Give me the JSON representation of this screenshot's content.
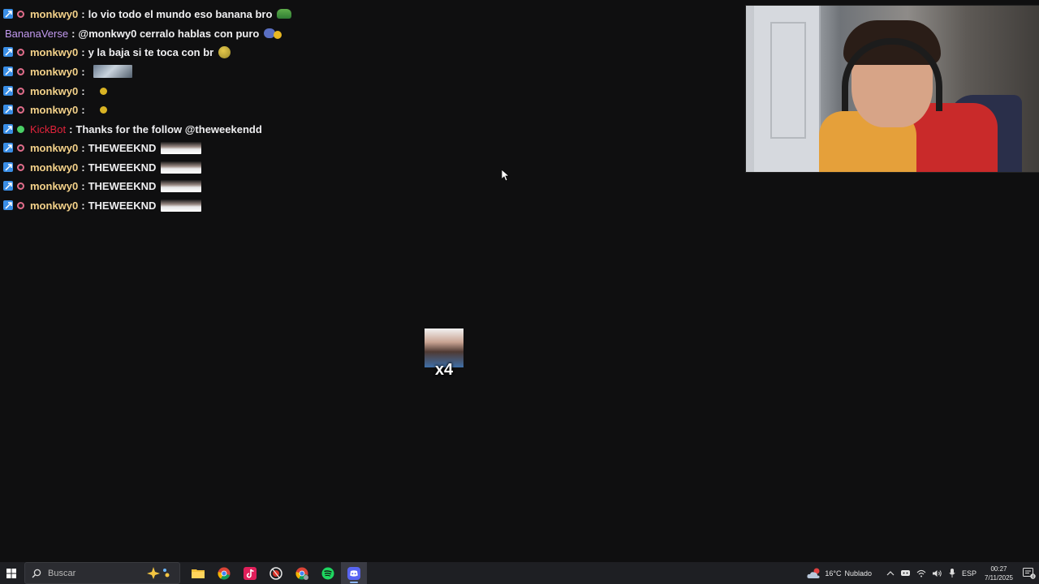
{
  "chat": {
    "messages": [
      {
        "user": "monkwy0",
        "user_color": "#f4d28a",
        "sep": ":",
        "text": "lo vio todo el mundo eso banana bro",
        "emote": "frog-emote"
      },
      {
        "user": "BananaVerse",
        "user_color": "#c39af0",
        "sep": ":",
        "text": "@monkwy0 cerralo hablas con puro",
        "emote": "combo-emote"
      },
      {
        "user": "monkwy0",
        "user_color": "#f4d28a",
        "sep": ":",
        "text": "y la baja si te toca con br",
        "emote": "ball-emote"
      },
      {
        "user": "monkwy0",
        "user_color": "#f4d28a",
        "sep": ":",
        "text": "",
        "emote": "picture-emote"
      },
      {
        "user": "monkwy0",
        "user_color": "#f4d28a",
        "sep": ":",
        "text": "",
        "emote": "small-emote"
      },
      {
        "user": "monkwy0",
        "user_color": "#f4d28a",
        "sep": ":",
        "text": "",
        "emote": "small-emote"
      },
      {
        "user": "KickBot",
        "user_color": "#e2233b",
        "sep": ":",
        "text": "Thanks for the follow @theweekendd",
        "emote": ""
      },
      {
        "user": "monkwy0",
        "user_color": "#f4d28a",
        "sep": ":",
        "text": "THEWEEKND",
        "emote": "face-emote"
      },
      {
        "user": "monkwy0",
        "user_color": "#f4d28a",
        "sep": ":",
        "text": "THEWEEKND",
        "emote": "face-emote"
      },
      {
        "user": "monkwy0",
        "user_color": "#f4d28a",
        "sep": ":",
        "text": "THEWEEKND",
        "emote": "face-emote"
      },
      {
        "user": "monkwy0",
        "user_color": "#f4d28a",
        "sep": ":",
        "text": "THEWEEKND",
        "emote": "face-emote"
      }
    ]
  },
  "alert": {
    "multiplier": "x4"
  },
  "taskbar": {
    "search_placeholder": "Buscar",
    "apps": [
      "file-explorer-icon",
      "chrome-icon",
      "tiktok-icon",
      "chrome-variant-icon",
      "chrome-profile-icon",
      "spotify-icon",
      "discord-icon"
    ],
    "weather": {
      "temp": "16°C",
      "condition": "Nublado"
    },
    "language": "ESP",
    "time": "00:27",
    "date": "7/11/2025",
    "notifications": "4"
  }
}
